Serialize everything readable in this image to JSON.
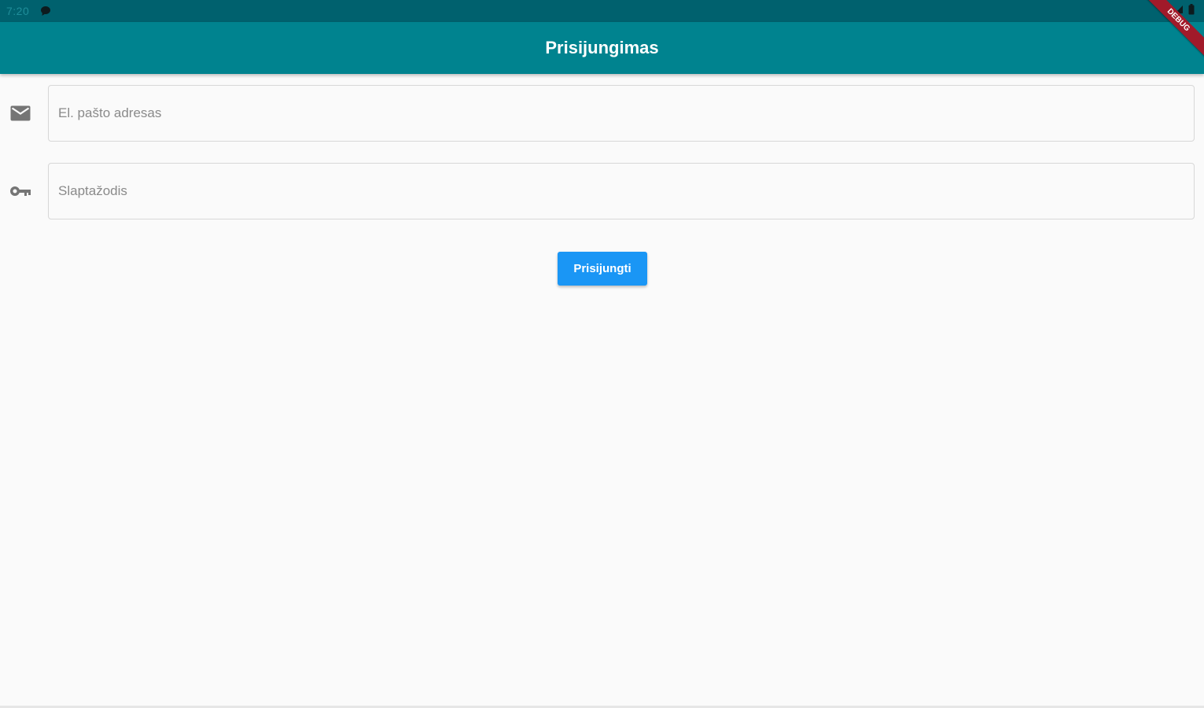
{
  "status_bar": {
    "time": "7:20",
    "icons": [
      "chat-icon",
      "wifi-icon",
      "signal-icon",
      "battery-icon"
    ]
  },
  "app_bar": {
    "title": "Prisijungimas",
    "background": "#00838f"
  },
  "debug_banner": {
    "label": "DEBUG"
  },
  "form": {
    "email": {
      "icon": "mail-icon",
      "placeholder": "El. pašto adresas",
      "value": ""
    },
    "password": {
      "icon": "key-icon",
      "placeholder": "Slaptažodis",
      "value": ""
    },
    "submit_label": "Prisijungti"
  },
  "colors": {
    "status_bar": "#00616e",
    "app_bar": "#00838f",
    "button": "#1a96f5",
    "debug_banner": "#a11a2a"
  }
}
